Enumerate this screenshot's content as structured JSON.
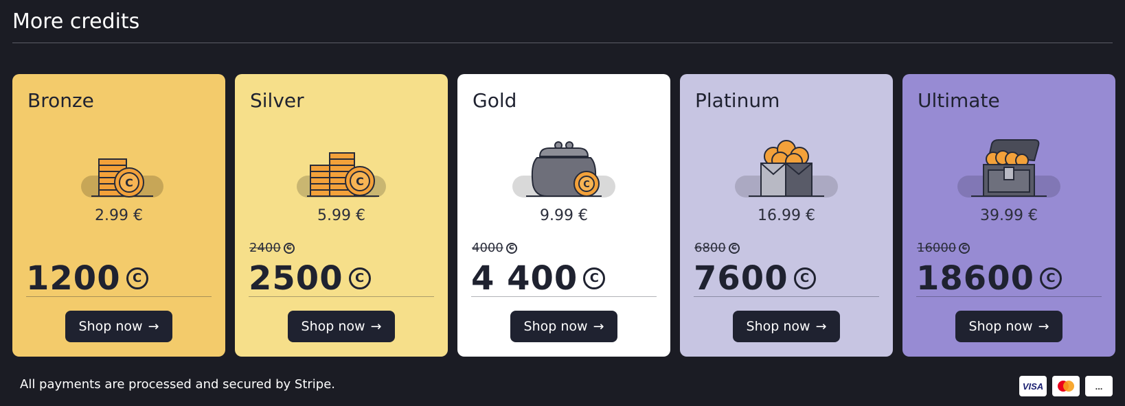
{
  "header": {
    "title": "More credits"
  },
  "cards": [
    {
      "name": "Bronze",
      "price": "2.99 €",
      "old_amount": "",
      "amount": "1200",
      "button": "Shop now",
      "color": "#f3cb6b",
      "icon": "coin-stack-icon"
    },
    {
      "name": "Silver",
      "price": "5.99 €",
      "old_amount": "2400",
      "amount": "2500",
      "button": "Shop now",
      "color": "#f6df8a",
      "icon": "double-coin-stack-icon"
    },
    {
      "name": "Gold",
      "price": "9.99 €",
      "old_amount": "4000",
      "amount": "4 400",
      "button": "Shop now",
      "color": "#ffffff",
      "icon": "coin-purse-icon"
    },
    {
      "name": "Platinum",
      "price": "16.99 €",
      "old_amount": "6800",
      "amount": "7600",
      "button": "Shop now",
      "color": "#c7c5e2",
      "icon": "coin-box-icon"
    },
    {
      "name": "Ultimate",
      "price": "39.99 €",
      "old_amount": "16000",
      "amount": "18600",
      "button": "Shop now",
      "color": "#978bd3",
      "icon": "treasure-chest-icon"
    }
  ],
  "currency_symbol": "C",
  "button_arrow": "→",
  "footer": {
    "text": "All payments are processed and secured by Stripe.",
    "payment_methods": [
      {
        "label": "VISA",
        "icon": "visa-icon"
      },
      {
        "label": "",
        "icon": "mastercard-icon"
      },
      {
        "label": "...",
        "icon": "more-payment-methods-icon"
      }
    ]
  }
}
